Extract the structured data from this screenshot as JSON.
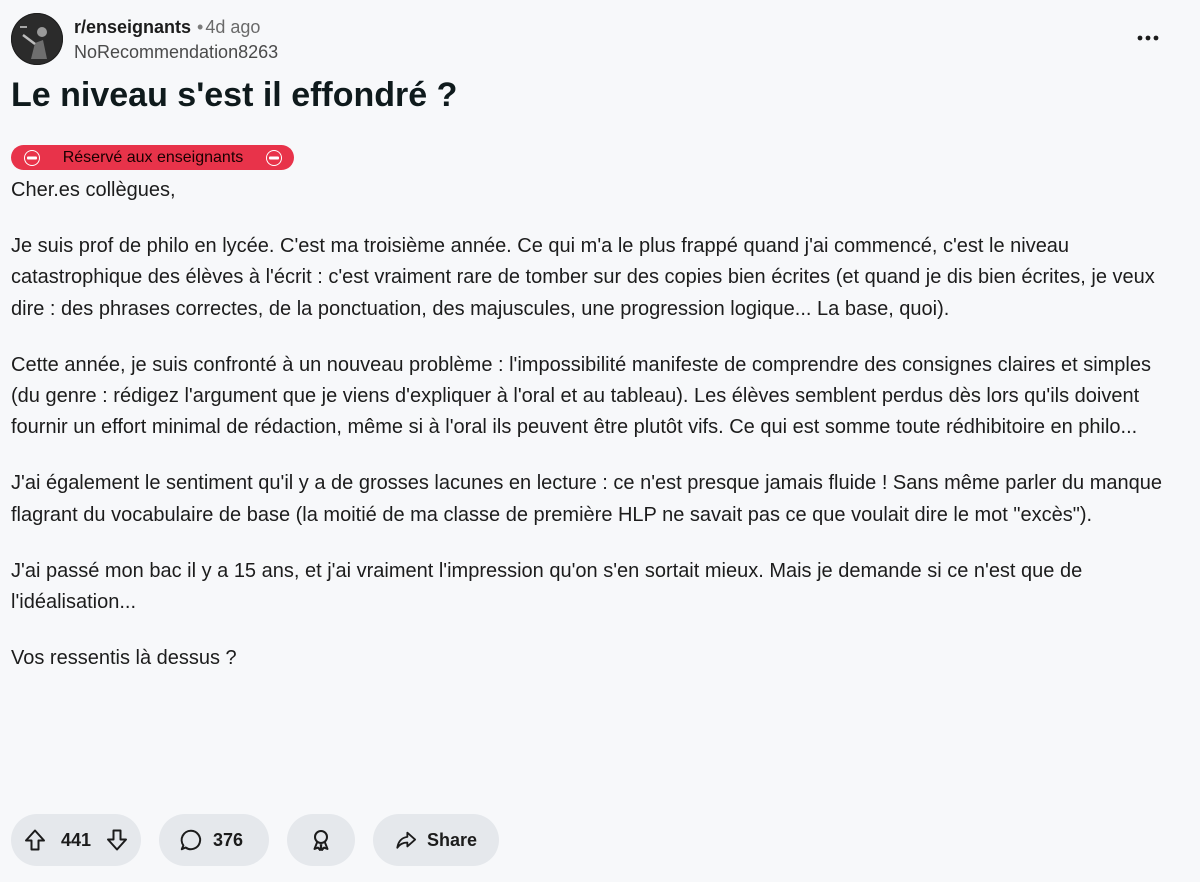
{
  "header": {
    "subreddit": "r/enseignants",
    "separator": "•",
    "age": "4d ago",
    "author": "NoRecommendation8263"
  },
  "post": {
    "title": "Le niveau s'est il effondré ?",
    "flair": {
      "label": "Réservé aux enseignants",
      "color": "#e8334a",
      "icon": "no-entry-icon"
    },
    "paragraphs": [
      "Cher.es collègues,",
      "Je suis prof de philo en lycée. C'est ma troisième année. Ce qui m'a le plus frappé quand j'ai commencé, c'est le niveau catastrophique des élèves à l'écrit : c'est vraiment rare de tomber sur des copies bien écrites (et quand je dis bien écrites, je veux dire : des phrases correctes, de la ponctuation, des majuscules, une progression logique... La base, quoi).",
      "Cette année, je suis confronté à un nouveau problème : l'impossibilité manifeste de comprendre des consignes claires et simples (du genre : rédigez l'argument que je viens d'expliquer à l'oral et au tableau). Les élèves semblent perdus dès lors qu'ils doivent fournir un effort minimal de rédaction, même si à l'oral ils peuvent être plutôt vifs. Ce qui est somme toute rédhibitoire en philo...",
      "J'ai également le sentiment qu'il y a de grosses lacunes en lecture : ce n'est presque jamais fluide ! Sans même parler du manque flagrant du vocabulaire de base (la moitié de ma classe de première HLP ne savait pas ce que voulait dire le mot \"excès\").",
      "J'ai passé mon bac il y a 15 ans, et j'ai vraiment l'impression qu'on s'en sortait mieux. Mais je demande si ce n'est que de l'idéalisation...",
      "Vos ressentis là dessus ?"
    ]
  },
  "actions": {
    "votes": "441",
    "comments": "376",
    "share_label": "Share",
    "icons": [
      "upvote-icon",
      "downvote-icon",
      "comment-icon",
      "award-icon",
      "share-icon",
      "more-options-icon"
    ]
  }
}
